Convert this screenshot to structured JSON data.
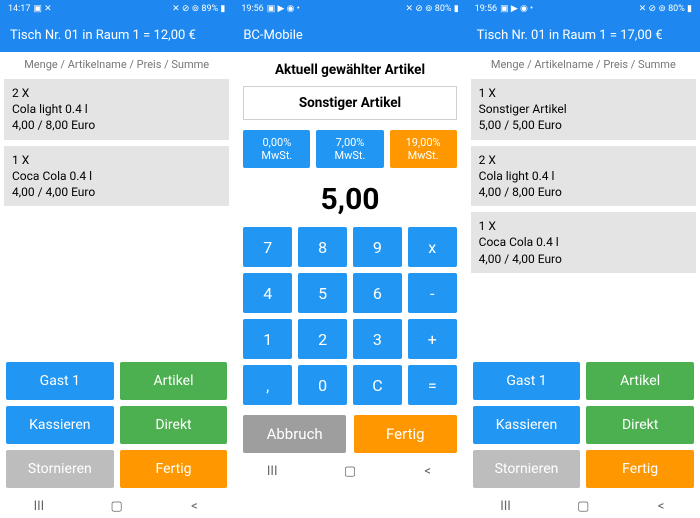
{
  "screen1": {
    "status": {
      "time": "14:17",
      "icons_left": "▣ ✕",
      "icons_right": "✕ ⊘ ⊚ 89% ▮"
    },
    "title": "Tisch Nr. 01 in Raum 1 = 12,00 €",
    "list_header": "Menge / Artikelname / Preis / Summe",
    "items": [
      {
        "qty": "2 X",
        "name": "Cola light 0.4 l",
        "price": "4,00 / 8,00 Euro"
      },
      {
        "qty": "1 X",
        "name": "Coca Cola 0.4 l",
        "price": "4,00 / 4,00 Euro"
      }
    ],
    "buttons": {
      "gast": "Gast 1",
      "artikel": "Artikel",
      "kassieren": "Kassieren",
      "direkt": "Direkt",
      "stornieren": "Stornieren",
      "fertig": "Fertig"
    }
  },
  "screen2": {
    "status": {
      "time": "19:56",
      "icons_left": "▣ ▶ ◉ •",
      "icons_right": "✕ ⊘ ⊚ 80% ▮"
    },
    "title": "BC-Mobile",
    "section": "Aktuell gewählter Artikel",
    "article": "Sonstiger Artikel",
    "tax": [
      {
        "l1": "0,00%",
        "l2": "MwSt."
      },
      {
        "l1": "7,00%",
        "l2": "MwSt."
      },
      {
        "l1": "19,00%",
        "l2": "MwSt."
      }
    ],
    "amount": "5,00",
    "keys": [
      "7",
      "8",
      "9",
      "x",
      "4",
      "5",
      "6",
      "-",
      "1",
      "2",
      "3",
      "+",
      ",",
      "0",
      "C",
      "="
    ],
    "abbruch": "Abbruch",
    "fertig": "Fertig"
  },
  "screen3": {
    "status": {
      "time": "19:56",
      "icons_left": "▣ ▶ ◉ •",
      "icons_right": "✕ ⊘ ⊚ 80% ▮"
    },
    "title": "Tisch Nr. 01 in Raum 1 = 17,00 €",
    "list_header": "Menge / Artikelname / Preis / Summe",
    "items": [
      {
        "qty": "1 X",
        "name": "Sonstiger Artikel",
        "price": "5,00 / 5,00 Euro"
      },
      {
        "qty": "2 X",
        "name": "Cola light 0.4 l",
        "price": "4,00 / 8,00 Euro"
      },
      {
        "qty": "1 X",
        "name": "Coca Cola 0.4 l",
        "price": "4,00 / 4,00 Euro"
      }
    ],
    "buttons": {
      "gast": "Gast 1",
      "artikel": "Artikel",
      "kassieren": "Kassieren",
      "direkt": "Direkt",
      "stornieren": "Stornieren",
      "fertig": "Fertig"
    }
  }
}
